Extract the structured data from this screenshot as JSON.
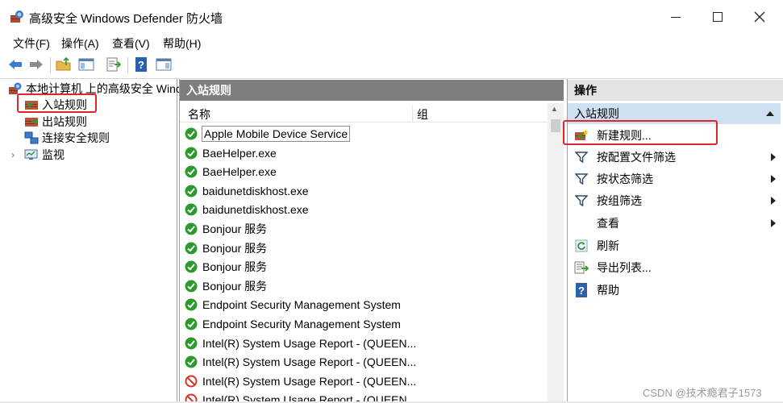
{
  "window": {
    "title": "高级安全 Windows Defender 防火墙"
  },
  "menu": {
    "items": [
      "文件(F)",
      "操作(A)",
      "查看(V)",
      "帮助(H)"
    ]
  },
  "tree": {
    "root": "本地计算机 上的高级安全 Winc",
    "inbound": "入站规则",
    "outbound": "出站规则",
    "connection": "连接安全规则",
    "monitor": "监视"
  },
  "center": {
    "header": "入站规则",
    "col_name": "名称",
    "col_group": "组",
    "rules": [
      {
        "name": "Apple Mobile Device Service",
        "status": "enabled"
      },
      {
        "name": "BaeHelper.exe",
        "status": "enabled"
      },
      {
        "name": "BaeHelper.exe",
        "status": "enabled"
      },
      {
        "name": "baidunetdiskhost.exe",
        "status": "enabled"
      },
      {
        "name": "baidunetdiskhost.exe",
        "status": "enabled"
      },
      {
        "name": "Bonjour 服务",
        "status": "enabled"
      },
      {
        "name": "Bonjour 服务",
        "status": "enabled"
      },
      {
        "name": "Bonjour 服务",
        "status": "enabled"
      },
      {
        "name": "Bonjour 服务",
        "status": "enabled"
      },
      {
        "name": "Endpoint Security Management System",
        "status": "enabled"
      },
      {
        "name": "Endpoint Security Management System",
        "status": "enabled"
      },
      {
        "name": "Intel(R) System Usage Report - (QUEEN...",
        "status": "enabled"
      },
      {
        "name": "Intel(R) System Usage Report - (QUEEN...",
        "status": "enabled"
      },
      {
        "name": "Intel(R) System Usage Report - (QUEEN...",
        "status": "blocked"
      },
      {
        "name": "Intel(R) System Usage Report - (QUEEN...",
        "status": "blocked"
      }
    ]
  },
  "actions": {
    "header": "操作",
    "section": "入站规则",
    "items": [
      {
        "label": "新建规则...",
        "icon": "new-rule-icon"
      },
      {
        "label": "按配置文件筛选",
        "icon": "filter-icon",
        "submenu": true
      },
      {
        "label": "按状态筛选",
        "icon": "filter-icon",
        "submenu": true
      },
      {
        "label": "按组筛选",
        "icon": "filter-icon",
        "submenu": true
      },
      {
        "label": "查看",
        "icon": "",
        "submenu": true
      },
      {
        "label": "刷新",
        "icon": "refresh-icon"
      },
      {
        "label": "导出列表...",
        "icon": "export-icon"
      },
      {
        "label": "帮助",
        "icon": "help-icon"
      }
    ]
  },
  "watermark": "CSDN @技术瘾君子1573",
  "colors": {
    "enabled": "#2c9a2c",
    "blocked": "#d9342b",
    "highlight_box": "#e0262c",
    "action_section_bg": "#cfe0f1",
    "center_header_bg": "#7e7e7e"
  }
}
